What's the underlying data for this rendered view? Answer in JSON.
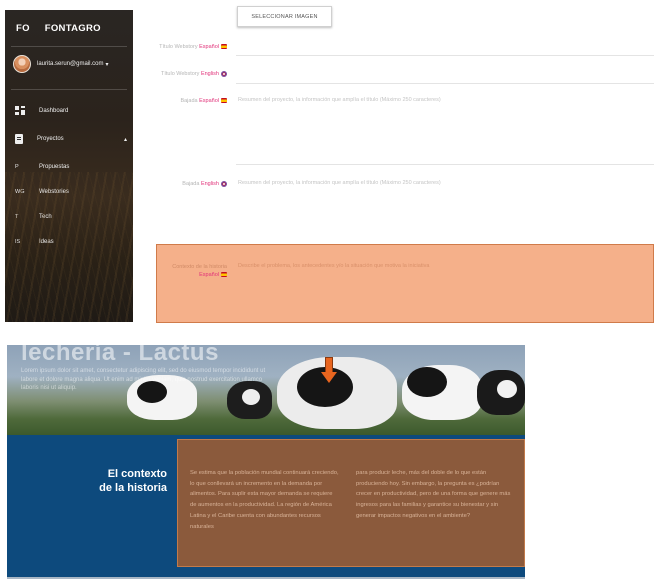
{
  "sidebar": {
    "brand_abbr": "FO",
    "brand_name": "FONTAGRO",
    "user_email": "laurita.serun@gmail.com",
    "user_caret": "▾",
    "items": [
      {
        "label": "Dashboard",
        "icon": "dashboard-icon"
      },
      {
        "label": "Proyectos",
        "icon": "projects-icon",
        "caret": "▴"
      },
      {
        "abbr": "P",
        "label": "Propuestas"
      },
      {
        "abbr": "WG",
        "label": "Webstories"
      },
      {
        "abbr": "T",
        "label": "Tech"
      },
      {
        "abbr": "IS",
        "label": "Ideas"
      }
    ]
  },
  "form": {
    "select_image_label": "SELECCIONAR IMAGEN",
    "lang_es": "Español",
    "lang_en": "English",
    "fields": [
      {
        "label": "Título Webstory",
        "lang": "es",
        "hint": ""
      },
      {
        "label": "Título Webstory",
        "lang": "en",
        "hint": ""
      },
      {
        "label": "Bajada",
        "lang": "es",
        "hint": "Resumen del proyecto, la información que amplía el título (Máximo 250 caracteres)"
      },
      {
        "label": "Bajada",
        "lang": "en",
        "hint": "Resumen del proyecto, la información que amplía el título (Máximo 250 caracteres)"
      },
      {
        "label": "Contexto de la historia",
        "lang": "es",
        "hint": "Describe el problema, los antecedentes y/o la situación que motiva la iniciativa"
      }
    ]
  },
  "story": {
    "hero_title": "lechería - Lactus",
    "hero_text": "Lorem ipsum dolor sit amet, consectetur adipiscing elit, sed do eiusmod tempor incididunt ut labore et dolore magna aliqua. Ut enim ad minim veniam, quis nostrud exercitation ullamco laboris nisi ut aliquip.",
    "context_title_line1": "El contexto",
    "context_title_line2": "de la historia",
    "context_col1": "Se estima que la población mundial continuará creciendo, lo que conllevará un incremento en la demanda por alimentos. Para suplir esta mayor demanda se requiere de aumentos en la productividad. La región de América Latina y el Caribe cuenta con abundantes recursos naturales",
    "context_col2": "para producir leche, más del doble de lo que están produciendo hoy. Sin embargo, la pregunta es ¿podrían crecer en productividad, pero de una forma que genere más ingresos para las familias y garantice su bienestar y sin generar impactos negativos en el ambiente?"
  },
  "colors": {
    "highlight_fill": "#f5b08a",
    "arrow": "#e8651f",
    "context_bg": "#0d4a7d",
    "context_box": "#8b5a3c",
    "lang_tag": "#e1337a"
  }
}
